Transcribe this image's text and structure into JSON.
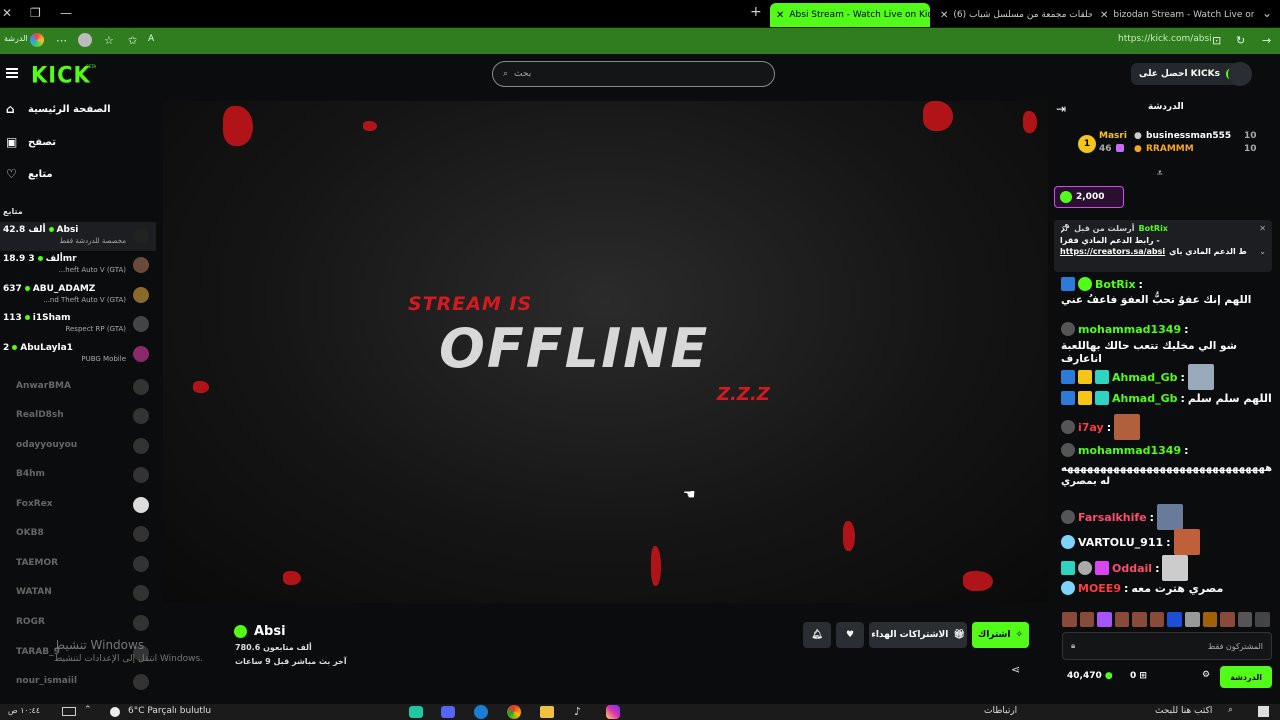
{
  "browser": {
    "tabs": [
      {
        "title": "Absi Stream - Watch Live on Kick",
        "active": true
      },
      {
        "title": "(6) حلقات مجمعة من مسلسل شباب...",
        "active": false
      },
      {
        "title": "bizodan Stream - Watch Live on K...",
        "active": false
      }
    ],
    "url": "https://kick.com/absi",
    "left_label": "الدرشة"
  },
  "header": {
    "logo": "KICK",
    "beta": "BETA",
    "search_placeholder": "بحث",
    "get_kicks": "احصل على KICKs"
  },
  "sidebar": {
    "nav": [
      {
        "label": "الصفحة الرئيسية",
        "icon": "home-icon"
      },
      {
        "label": "تصفح",
        "icon": "browse-icon"
      },
      {
        "label": "متابع",
        "icon": "heart-icon"
      }
    ],
    "following_title": "متابع",
    "live_channels": [
      {
        "name": "Absi",
        "count": "42.8 ألف",
        "game": "مخصصة للدردشة فقط"
      },
      {
        "name": "3mr",
        "count": "18.9 ألف",
        "game": "...heft Auto V (GTA)"
      },
      {
        "name": "ABU_ADAMZ",
        "count": "637",
        "game": "...nd Theft Auto V (GTA)"
      },
      {
        "name": "i1Sham",
        "count": "113",
        "game": "Respect RP (GTA)"
      },
      {
        "name": "AbuLayla1",
        "count": "2",
        "game": "PUBG Mobile"
      }
    ],
    "offline_channels": [
      "AnwarBMA",
      "RealD8sh",
      "odayyouyou",
      "B4hm",
      "FoxRex",
      "OKB8",
      "TAEMOR",
      "WATAN",
      "ROGR",
      "TARAB_9",
      "nour_ismaiil"
    ]
  },
  "video": {
    "line1": "STREAM IS",
    "line2": "OFFLINE",
    "tag": "Z.Z.Z"
  },
  "channel": {
    "name": "Absi",
    "followers": "780.6 ألف متابعون",
    "last_live": "آخر بث مباشر قبل 9 ساعات",
    "subscribe": "اشتراك",
    "gift_subs": "الاشتراكات الهداء",
    "windows_watermark_1": "تنشيط Windows",
    "windows_watermark_2": "انتقل إلى الإعدادات لتنشيط Windows."
  },
  "chat": {
    "title": "الدردشة",
    "leaderboard": [
      {
        "name": "Masri",
        "value": "46"
      },
      {
        "name": "businessman555",
        "value": "10"
      },
      {
        "name": "RRAMMM",
        "value": "10"
      }
    ],
    "rank": "1",
    "kicks_balance": "2,000",
    "pinned": {
      "by": "BotRix",
      "meta": "أرسلت من قبل",
      "line1": "- رابط الدعم المادي فقرا",
      "link": "https://creators.sa/absi",
      "line2": "ط الدعم المادي باي"
    },
    "messages": [
      {
        "user": "BotRix",
        "text": "اللهم إنك عفوٌ تحبُّ العفوَ فاعفُ عني",
        "color": "#53fc18"
      },
      {
        "user": "mohammad1349",
        "text": "شو الي مخليك تتعب حالك بهاللعبة اناعارف",
        "color": "#53fc18"
      },
      {
        "user": "Ahmad_Gb",
        "text": "",
        "color": "#53fc18"
      },
      {
        "user": "Ahmad_Gb",
        "text": "اللهم سلم سلم",
        "color": "#53fc18"
      },
      {
        "user": "i7ay",
        "text": "",
        "color": "#ff3b3b"
      },
      {
        "user": "mohammad1349",
        "text": "هههههههههههههههههههههههههههههههه له بمصري",
        "color": "#53fc18"
      },
      {
        "user": "Farsalkhife",
        "text": "",
        "color": "#ff4b6e"
      },
      {
        "user": "VARTOLU_911",
        "text": "",
        "color": "#ffffff"
      },
      {
        "user": "Oddail",
        "text": "",
        "color": "#ff4b6e"
      },
      {
        "user": "MOEE9",
        "text": "مصري هترت معه",
        "color": "#ff3b3b"
      }
    ],
    "input_placeholder": "المشتركون فقط",
    "kick_points": "40,470",
    "gift_count": "0",
    "chat_button": "الدردشة"
  },
  "taskbar": {
    "weather": "6°C  Parçalı bulutlu",
    "search": "اكتب هنا للبحث",
    "links": "ارتباطات",
    "time": "١٠:٤٤ ص"
  },
  "colors": {
    "accent": "#53fc18",
    "offline_red": "#d21a1f",
    "bg": "#0b0c0d"
  }
}
